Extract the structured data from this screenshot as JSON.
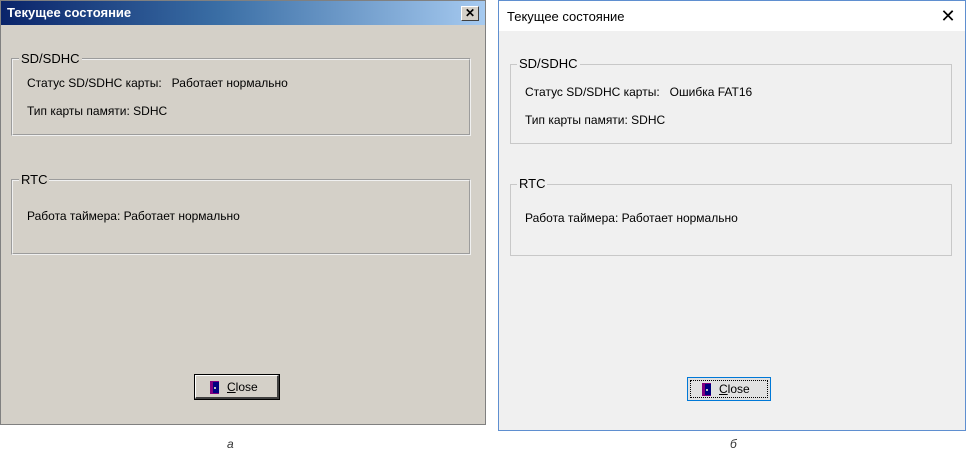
{
  "left": {
    "title": "Текущее состояние",
    "close_glyph": "✕",
    "sd_group": {
      "legend": "SD/SDHC",
      "status_label": "Статус SD/SDHC карты:",
      "status_value": "Работает нормально",
      "type_line": "Тип карты памяти: SDHC"
    },
    "rtc_group": {
      "legend": "RTC",
      "timer_line": "Работа таймера: Работает нормально"
    },
    "close_button": {
      "label": "Close",
      "icon": "door-icon"
    },
    "caption": "а"
  },
  "right": {
    "title": "Текущее состояние",
    "close_glyph": "✕",
    "sd_group": {
      "legend": "SD/SDHC",
      "status_label": "Статус SD/SDHC карты:",
      "status_value": "Ошибка FAT16",
      "type_line": "Тип карты памяти: SDHC"
    },
    "rtc_group": {
      "legend": "RTC",
      "timer_line": "Работа таймера: Работает нормально"
    },
    "close_button": {
      "label": "Close",
      "icon": "door-icon"
    },
    "caption": "б"
  }
}
